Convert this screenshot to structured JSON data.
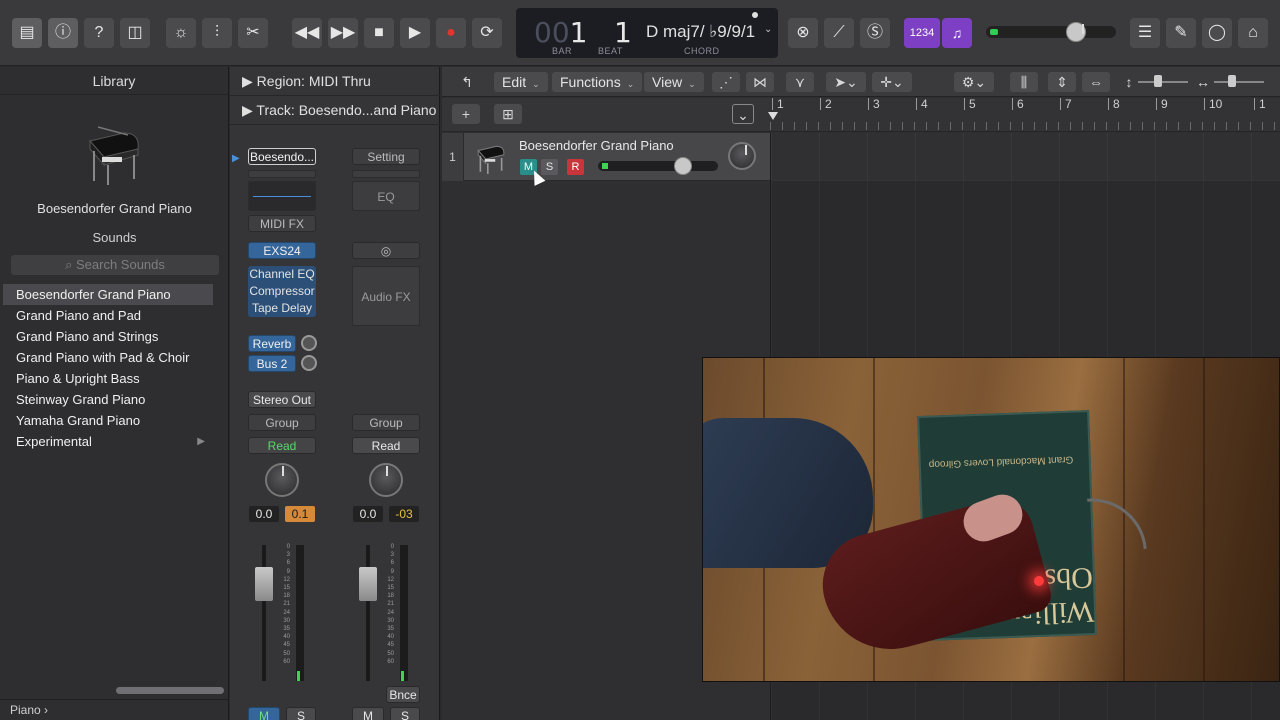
{
  "toolbar": {
    "lcd": {
      "bar_dim": "00",
      "bar": "1",
      "beat": "1",
      "bar_label": "BAR",
      "beat_label": "BEAT",
      "chord": "D maj7/ ♭9/9/1",
      "chord_label": "CHORD"
    },
    "count_in": "1234",
    "icons": [
      "library-icon",
      "info-icon",
      "help-icon",
      "editors-icon",
      "smart-controls-icon",
      "mixer-icon",
      "scissors-icon",
      "rewind-icon",
      "fast-forward-icon",
      "stop-icon",
      "play-icon",
      "record-icon",
      "cycle-icon",
      "list-icon",
      "notes-icon",
      "loop-browser-icon",
      "browser-icon"
    ],
    "master_volume": 0.72
  },
  "library": {
    "title": "Library",
    "patch": "Boesendorfer Grand Piano",
    "sounds_label": "Sounds",
    "search_placeholder": "Search Sounds",
    "items": [
      {
        "label": "Boesendorfer Grand Piano",
        "selected": true
      },
      {
        "label": "Grand Piano and Pad"
      },
      {
        "label": "Grand Piano and Strings"
      },
      {
        "label": "Grand Piano with Pad & Choir"
      },
      {
        "label": "Piano & Upright Bass"
      },
      {
        "label": "Steinway Grand Piano"
      },
      {
        "label": "Yamaha Grand Piano"
      },
      {
        "label": "Experimental",
        "has_children": true
      }
    ],
    "footer": "Piano",
    "footer_arrow": "›"
  },
  "inspector": {
    "region_label": "Region:",
    "region_value": "MIDI Thru",
    "track_label": "Track:",
    "track_value": "Boesendo...and Piano",
    "strip1": {
      "patch": "Boesendo...",
      "midi_fx": "MIDI FX",
      "instrument": "EXS24",
      "fx": [
        "Channel EQ",
        "Compressor",
        "Tape Delay"
      ],
      "sends": [
        "Reverb",
        "Bus 2"
      ],
      "output": "Stereo Out",
      "group": "Group",
      "automation": "Read",
      "volume": "0.0",
      "pan": "0.1",
      "mute": "M",
      "solo": "S"
    },
    "strip2": {
      "setting": "Setting",
      "eq": "EQ",
      "audio_fx": "Audio FX",
      "group": "Group",
      "automation": "Read",
      "volume": "0.0",
      "pan": "-03",
      "bounce": "Bnce",
      "mute": "M",
      "solo": "S"
    },
    "scale": [
      "0",
      "3",
      "6",
      "9",
      "12",
      "15",
      "18",
      "21",
      "24",
      "30",
      "35",
      "40",
      "45",
      "50",
      "60"
    ]
  },
  "tracks": {
    "menus": [
      "Edit",
      "Functions",
      "View"
    ],
    "track": {
      "number": "1",
      "name": "Boesendorfer Grand Piano",
      "mute": "M",
      "solo": "S",
      "record": "R"
    },
    "ruler": [
      "1",
      "2",
      "3",
      "4",
      "5",
      "6",
      "7",
      "8",
      "9",
      "10",
      "1"
    ]
  },
  "video": {
    "box_text": "Grant Macdonald Lovers Gilroop",
    "box_big": "William Obst"
  }
}
